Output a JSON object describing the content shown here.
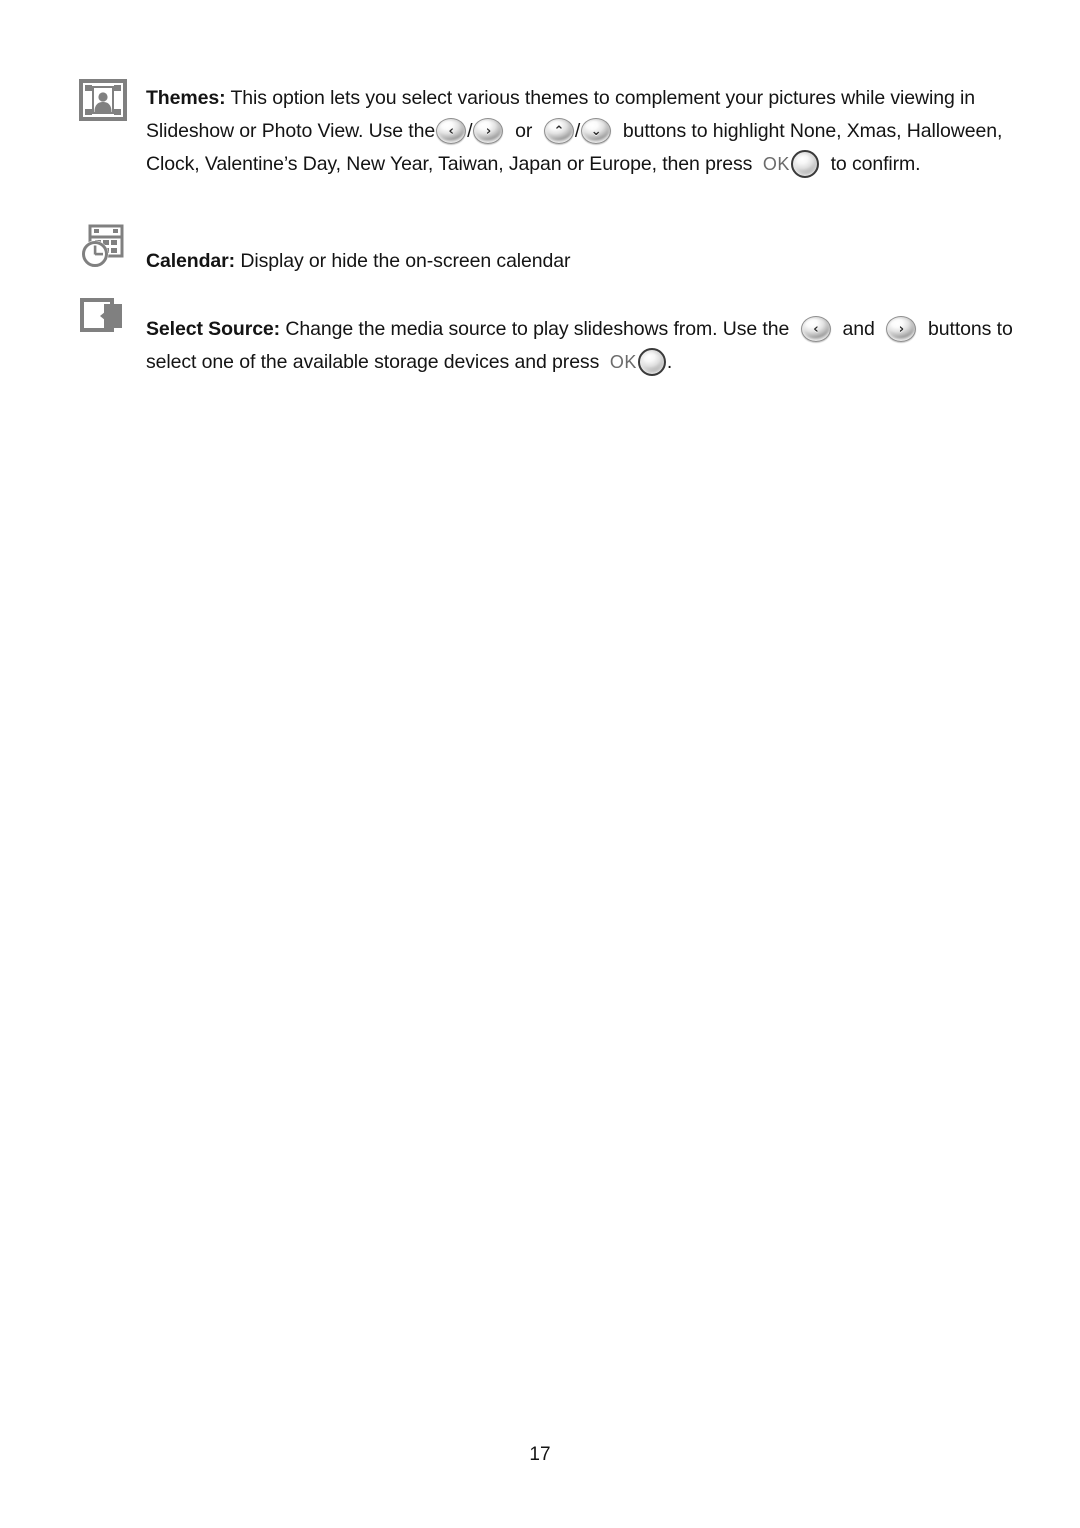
{
  "document": {
    "page_number": "17",
    "colors": {
      "icon_gray": "#808080",
      "text_black": "#141414",
      "ok_label_gray": "#6b6b6b"
    }
  },
  "entries": [
    {
      "id": "themes",
      "icon": "photo-frame-icon",
      "term": "Themes:",
      "text_1": " This option lets you select various themes to complement your pictures while viewing in Slideshow or Photo View. Use the",
      "sep": "/",
      "text_2": "or",
      "text_3": "buttons to highlight None, Xmas, Halloween, Clock, Valentine’s Day, New Year, Taiwan, Japan or Europe, then press",
      "ok_label": "OK",
      "text_4": "to confirm.",
      "buttons": [
        {
          "name": "left-arrow-button",
          "glyph": "‹"
        },
        {
          "name": "right-arrow-button",
          "glyph": "›"
        },
        {
          "name": "up-arrow-button",
          "glyph": "⌃"
        },
        {
          "name": "down-arrow-button",
          "glyph": "⌄"
        },
        {
          "name": "ok-button",
          "glyph": ""
        }
      ]
    },
    {
      "id": "calendar",
      "icon": "calendar-clock-icon",
      "term": "Calendar:",
      "text_1": " Display or hide the on-screen calendar"
    },
    {
      "id": "select-source",
      "icon": "select-source-icon",
      "term": "Select Source:",
      "text_1": " Change the media source to play slideshows from. Use the",
      "text_2": "and",
      "text_3": "buttons to select one of the available storage devices and press",
      "ok_label": "OK",
      "text_4": ".",
      "buttons": [
        {
          "name": "left-arrow-button",
          "glyph": "‹"
        },
        {
          "name": "right-arrow-button",
          "glyph": "›"
        },
        {
          "name": "ok-button",
          "glyph": ""
        }
      ]
    }
  ]
}
